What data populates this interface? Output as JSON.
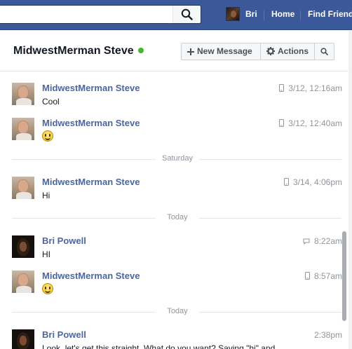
{
  "topbar": {
    "search_placeholder": "",
    "user_name": "Bri",
    "nav_home": "Home",
    "nav_find_friends": "Find Friends"
  },
  "header": {
    "title": "MidwestMerman Steve",
    "online": true,
    "new_message_label": "New Message",
    "actions_label": "Actions"
  },
  "messages": [
    {
      "sender": "MidwestMerman Steve",
      "text": "Cool",
      "time": "3/12, 12:16am",
      "avatar": "steve",
      "source": "mobile"
    },
    {
      "sender": "MidwestMerman Steve",
      "text": "",
      "emoji": "smiley",
      "time": "3/12, 12:40am",
      "avatar": "steve",
      "source": "mobile"
    },
    {
      "divider": "Saturday"
    },
    {
      "sender": "MidwestMerman Steve",
      "text": "Hi",
      "time": "3/14, 4:06pm",
      "avatar": "steve",
      "source": "mobile"
    },
    {
      "divider": "Today"
    },
    {
      "sender": "Bri Powell",
      "text": "HI",
      "time": "8:22am",
      "avatar": "bri",
      "source": "chat"
    },
    {
      "sender": "MidwestMerman Steve",
      "text": "",
      "emoji": "smiley",
      "time": "8:57am",
      "avatar": "steve",
      "source": "mobile"
    },
    {
      "divider": "Today"
    },
    {
      "sender": "Bri Powell",
      "text": "Look, let's get this straight. What do you want? Saying \"hi\" and",
      "time": "2:38pm",
      "avatar": "bri",
      "source": ""
    }
  ],
  "colors": {
    "brand": "#3b5998",
    "sender": "#4b66a0",
    "online": "#42b72a",
    "muted": "#90949c"
  }
}
